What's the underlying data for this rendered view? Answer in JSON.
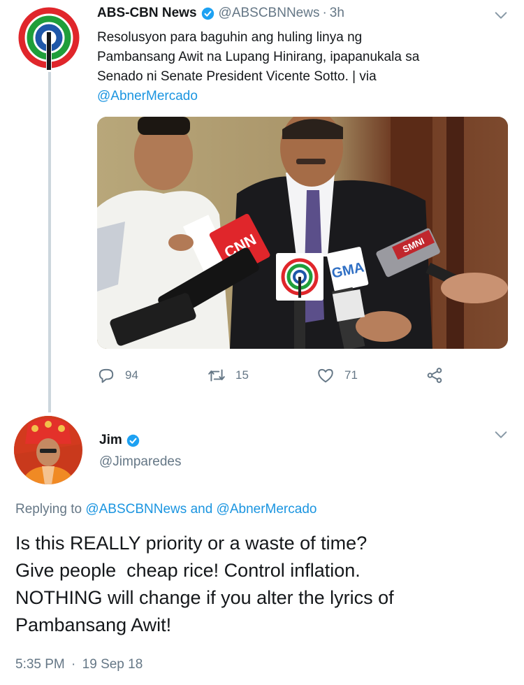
{
  "tweet1": {
    "author_name": "ABS-CBN News",
    "handle": "@ABSCBNNews",
    "separator": "·",
    "time": "3h",
    "text_lines": [
      "Resolusyon para baguhin ang huling linya ng",
      "Pambansang Awit na Lupang Hinirang, ipapanukala sa",
      "Senado ni Senate President Vicente Sotto. | via"
    ],
    "text_mention": "@AbnerMercado",
    "photo_mic_labels": [
      "CNN",
      "GMA",
      "SMNI"
    ],
    "actions": {
      "replies": "94",
      "retweets": "15",
      "likes": "71"
    },
    "icons": [
      "verified-icon",
      "chevron-down-icon",
      "reply-icon",
      "retweet-icon",
      "like-icon",
      "share-icon"
    ]
  },
  "tweet2": {
    "author_name": "Jim",
    "handle": "@Jimparedes",
    "reply_prefix": "Replying to",
    "reply_mention_1": "@ABSCBNNews",
    "reply_and": "and",
    "reply_mention_2": "@AbnerMercado",
    "text_lines": [
      "Is this REALLY priority or a waste of time?",
      "Give people  cheap rice! Control inflation.",
      "NOTHING will change if you alter the lyrics of",
      "Pambansang Awit!"
    ],
    "time": "5:35 PM",
    "separator": "·",
    "date": "19 Sep 18"
  },
  "colors": {
    "accent": "#1b95e0",
    "secondary_text": "#657786",
    "thread_line": "#ccd6dd",
    "abs_red": "#e0262b",
    "abs_green": "#1f9e3a",
    "abs_blue": "#1f57a8"
  }
}
